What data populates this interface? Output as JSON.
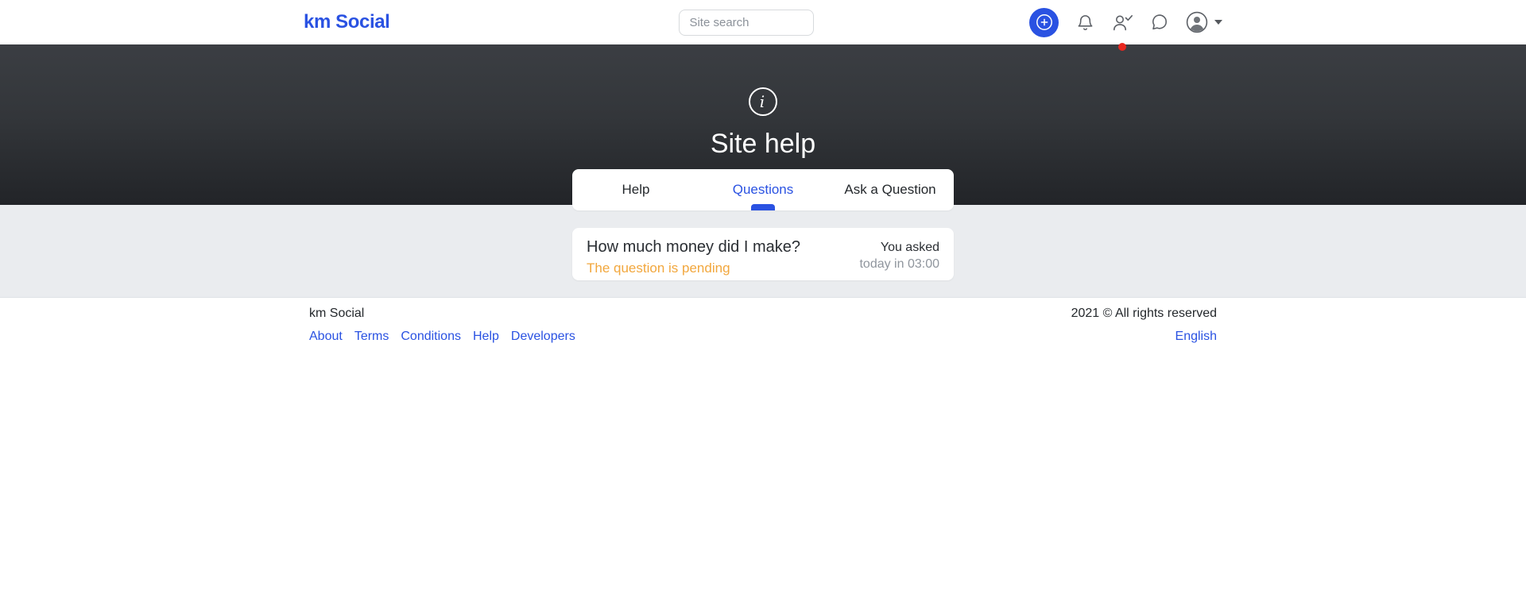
{
  "navbar": {
    "logo": "km Social",
    "search": {
      "placeholder": "Site search"
    }
  },
  "banner": {
    "title": "Site help"
  },
  "tabs": [
    {
      "label": "Help",
      "active": false
    },
    {
      "label": "Questions",
      "active": true
    },
    {
      "label": "Ask a Question",
      "active": false
    }
  ],
  "question": {
    "title": "How much money did I make?",
    "status": "The question is pending",
    "meta_line1": "You asked",
    "meta_line2": "today in 03:00"
  },
  "footer": {
    "brand": "km Social",
    "copyright": "2021 © All rights reserved",
    "links": [
      "About",
      "Terms",
      "Conditions",
      "Help",
      "Developers"
    ],
    "language": "English"
  },
  "colors": {
    "accent": "#2a52e2",
    "pending_amber": "#f2a73d",
    "banner_top": "#3b3e43",
    "banner_bottom": "#222428",
    "section_bg": "#eaecef",
    "notification_red": "#e8271f"
  }
}
